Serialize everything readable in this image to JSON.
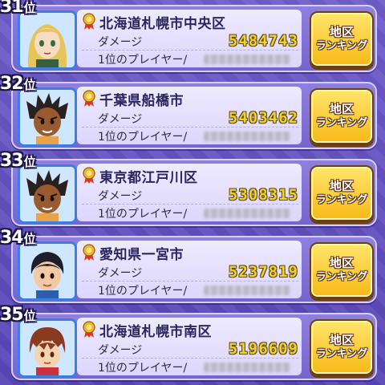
{
  "ranking": {
    "rank_suffix": "位",
    "damage_label": "ダメージ",
    "top_player_label": "1位のプレイヤー/",
    "button_line1": "地区",
    "button_line2": "ランキング",
    "entries": [
      {
        "rank": "31",
        "area": "北海道札幌市中央区",
        "damage": "5484743",
        "avatar": "blonde-girl"
      },
      {
        "rank": "32",
        "area": "千葉県船橋市",
        "damage": "5403462",
        "avatar": "dark-spiky-boy"
      },
      {
        "rank": "33",
        "area": "東京都江戸川区",
        "damage": "5308315",
        "avatar": "dark-spiky-boy"
      },
      {
        "rank": "34",
        "area": "愛知県一宮市",
        "damage": "5237819",
        "avatar": "black-hair-boy"
      },
      {
        "rank": "35",
        "area": "北海道札幌市南区",
        "damage": "5196609",
        "avatar": "brown-hair-boy"
      }
    ]
  },
  "colors": {
    "damage_text": "#f3d12a",
    "avatar_border": "#3c7ee4",
    "button_fill": "#f7b918"
  }
}
